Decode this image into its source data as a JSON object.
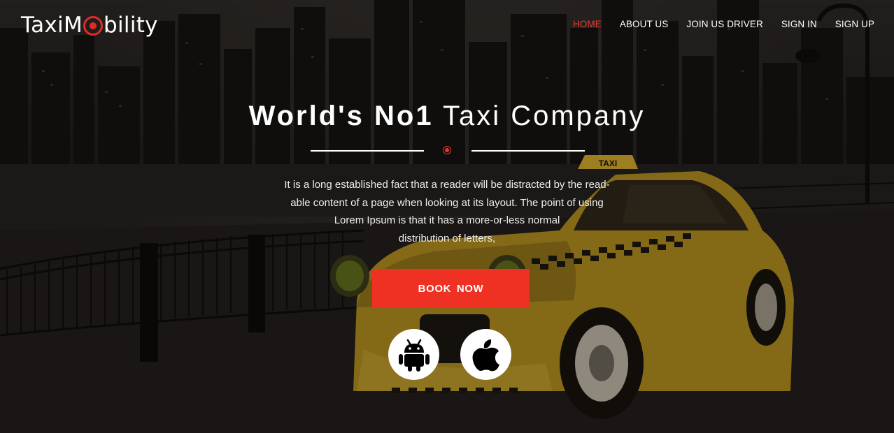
{
  "header": {
    "logo": {
      "prefix": "TaxiM",
      "suffix": "bility"
    },
    "nav": [
      {
        "label": "HOME",
        "active": true
      },
      {
        "label": "ABOUT US",
        "active": false
      },
      {
        "label": "JOIN US DRIVER",
        "active": false
      },
      {
        "label": "SIGN IN",
        "active": false
      },
      {
        "label": "SIGN UP",
        "active": false
      }
    ]
  },
  "hero": {
    "headline_bold": "World's No1",
    "headline_light": "Taxi Company",
    "description_lines": [
      "It is a long established fact that a reader will be distracted by the read-",
      "able content of a page when looking at its layout. The point of using",
      "Lorem Ipsum is that it has a more-or-less normal",
      "distribution of letters,"
    ],
    "book_button": "BOOK  NOW",
    "app_buttons": [
      {
        "icon": "android-icon"
      },
      {
        "icon": "apple-icon"
      }
    ],
    "taxi_sign": "TAXI"
  },
  "colors": {
    "accent": "#ef3124",
    "nav_active": "#e8382d",
    "taxi_yellow": "#c8a020"
  }
}
